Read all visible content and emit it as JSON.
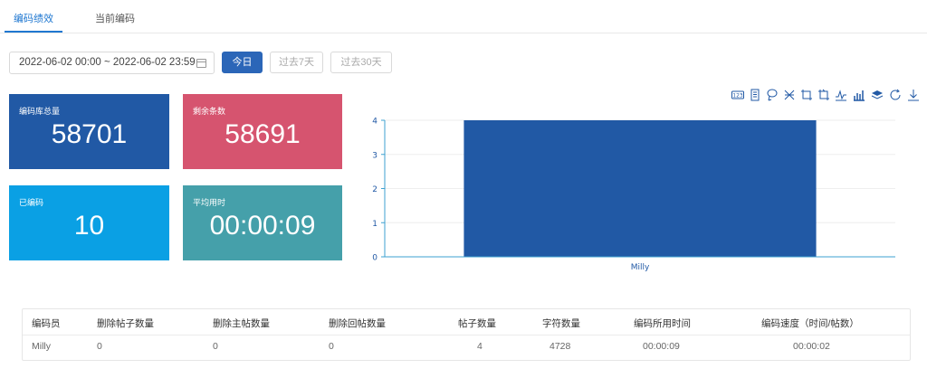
{
  "tabs": [
    {
      "label": "编码绩效",
      "active": true
    },
    {
      "label": "当前编码",
      "active": false
    }
  ],
  "date_range": {
    "value": "2022-06-02 00:00 ~ 2022-06-02 23:59"
  },
  "buttons": {
    "today": "今日",
    "last7": "过去7天",
    "last30": "过去30天"
  },
  "cards": [
    {
      "label": "编码库总量",
      "value": "58701",
      "color": "#2159a5"
    },
    {
      "label": "剩余条数",
      "value": "58691",
      "color": "#d6546f"
    },
    {
      "label": "已编码",
      "value": "10",
      "color": "#0aa0e4"
    },
    {
      "label": "平均用时",
      "value": "00:00:09",
      "color": "#45a0aa"
    }
  ],
  "toolbox_icons": [
    "data-view-icon",
    "document-icon",
    "lasso-icon",
    "zoom-icon",
    "rect-select-icon",
    "rect-select-alt-icon",
    "line-chart-icon",
    "bar-chart-icon",
    "stack-icon",
    "refresh-icon",
    "download-icon"
  ],
  "chart_data": {
    "type": "bar",
    "categories": [
      "Milly"
    ],
    "values": [
      4
    ],
    "ylim": [
      0,
      4
    ],
    "yticks": [
      0,
      1,
      2,
      3,
      4
    ],
    "grid": true,
    "bar_color": "#2159a5",
    "axis_color": "#3ca0d0"
  },
  "table": {
    "headers": [
      "编码员",
      "删除帖子数量",
      "删除主帖数量",
      "删除回帖数量",
      "帖子数量",
      "字符数量",
      "编码所用时间",
      "编码速度（时间/帖数）"
    ],
    "rows": [
      [
        "Milly",
        "0",
        "0",
        "0",
        "4",
        "4728",
        "00:00:09",
        "00:00:02"
      ]
    ]
  }
}
